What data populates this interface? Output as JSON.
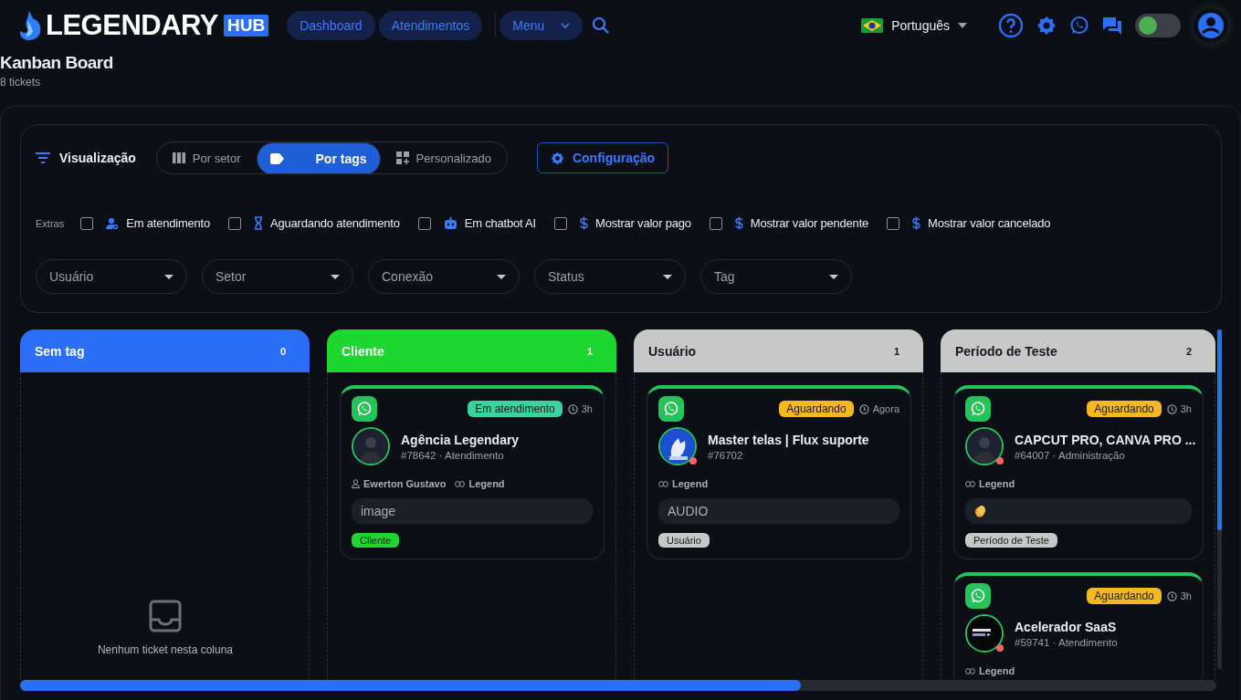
{
  "brand": {
    "name": "LEGENDARY",
    "badge": "HUB"
  },
  "nav": [
    {
      "label": "Dashboard",
      "kind": "link"
    },
    {
      "label": "Atendimentos",
      "kind": "link"
    },
    {
      "label": "Menu",
      "kind": "menu"
    }
  ],
  "language": {
    "label": "Português"
  },
  "dark_mode": {
    "on": true
  },
  "page": {
    "title": "Kanban Board",
    "subtitle": "8 tickets"
  },
  "view": {
    "label": "Visualização",
    "options": [
      {
        "label": "Por setor",
        "kind": "columns",
        "selected": false
      },
      {
        "label": "Por tags",
        "kind": "tag",
        "selected": true
      },
      {
        "label": "Personalizado",
        "kind": "grid",
        "selected": false
      }
    ],
    "settings_button": "Configuração"
  },
  "extras": {
    "label": "Extras",
    "options": [
      {
        "label": "Em atendimento",
        "kind": "person",
        "checked": false
      },
      {
        "label": "Aguardando atendimento",
        "kind": "hourglass",
        "checked": false
      },
      {
        "label": "Em chatbot AI",
        "kind": "robot",
        "checked": false
      },
      {
        "label": "Mostrar valor pago",
        "kind": "dollar",
        "checked": false
      },
      {
        "label": "Mostrar valor pendente",
        "kind": "dollar",
        "checked": false
      },
      {
        "label": "Mostrar valor cancelado",
        "kind": "dollar",
        "checked": false
      }
    ]
  },
  "filters": [
    {
      "placeholder": "Usuário"
    },
    {
      "placeholder": "Setor"
    },
    {
      "placeholder": "Conexão"
    },
    {
      "placeholder": "Status"
    },
    {
      "placeholder": "Tag"
    }
  ],
  "columns": [
    {
      "title": "Sem tag",
      "count": "0",
      "color": "#2a6ff5",
      "empty_text": "Nenhum ticket nesta coluna"
    },
    {
      "title": "Cliente",
      "count": "1",
      "color": "#1ed62e",
      "tickets": [
        {
          "name": "Agência Legendary",
          "sub": "#78642 · Atendimento",
          "status": {
            "label": "Em atendimento",
            "color": "#3ad29f"
          },
          "time": "3h",
          "offline": false,
          "user": "Ewerton Gustavo",
          "connection": "Legend",
          "message": {
            "kind": "text",
            "text": "image"
          },
          "tag": {
            "label": "Cliente",
            "color": "#1ed62e"
          }
        }
      ]
    },
    {
      "title": "Usuário",
      "count": "1",
      "color": "#c8c8c8",
      "tickets": [
        {
          "name": "Master telas | Flux suporte",
          "sub": "#76702",
          "status": {
            "label": "Aguardando",
            "color": "#f5b820"
          },
          "time": "Agora",
          "offline": true,
          "connection": "Legend",
          "message": {
            "kind": "text",
            "text": "AUDIO"
          },
          "tag": {
            "label": "Usuário",
            "color": "#c8c8c8"
          }
        }
      ]
    },
    {
      "title": "Período de Teste",
      "count": "2",
      "color": "#c8c8c8",
      "tickets": [
        {
          "name": "CAPCUT PRO, CANVA PRO ...",
          "sub": "#64007 · Administração",
          "status": {
            "label": "Aguardando",
            "color": "#f5b820"
          },
          "time": "3h",
          "offline": true,
          "connection": "Legend",
          "message": {
            "kind": "emoji"
          },
          "tag": {
            "label": "Período de Teste",
            "color": "#c8c8c8"
          }
        },
        {
          "name": "Acelerador SaaS",
          "sub": "#59741 · Atendimento",
          "status": {
            "label": "Aguardando",
            "color": "#f5b820"
          },
          "time": "3h",
          "offline": true,
          "connection": "Legend"
        }
      ]
    }
  ]
}
